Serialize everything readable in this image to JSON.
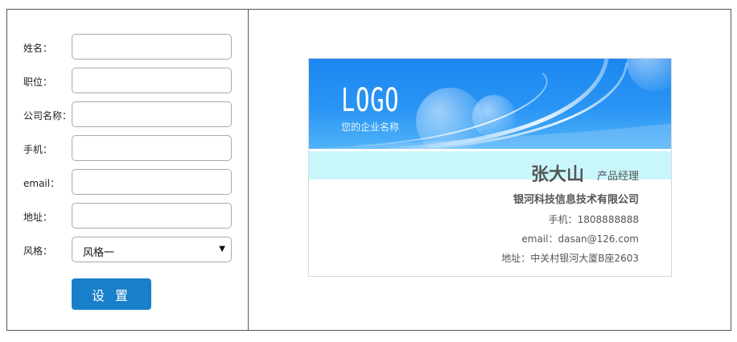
{
  "form": {
    "fields": [
      {
        "label": "姓名：",
        "value": "",
        "placeholder": ""
      },
      {
        "label": "职位：",
        "value": "",
        "placeholder": ""
      },
      {
        "label": "公司名称：",
        "value": "",
        "placeholder": ""
      },
      {
        "label": "手机：",
        "value": "",
        "placeholder": ""
      },
      {
        "label": "email：",
        "value": "",
        "placeholder": ""
      },
      {
        "label": "地址：",
        "value": "",
        "placeholder": ""
      }
    ],
    "style_label": "风格：",
    "style_value": "风格一",
    "submit_label": "设 置"
  },
  "card": {
    "logo": "LOGO",
    "logo_subtitle": "您的企业名称",
    "name": "张大山",
    "title": "产品经理",
    "company": "银河科技信息技术有限公司",
    "phone": "手机：1808888888",
    "email": "email：dasan@126.com",
    "address": "地址：中关村银河大厦B座2603",
    "colors": {
      "banner": "#1b86f0",
      "band": "#c9f6fb",
      "button": "#1a7fc9"
    }
  }
}
